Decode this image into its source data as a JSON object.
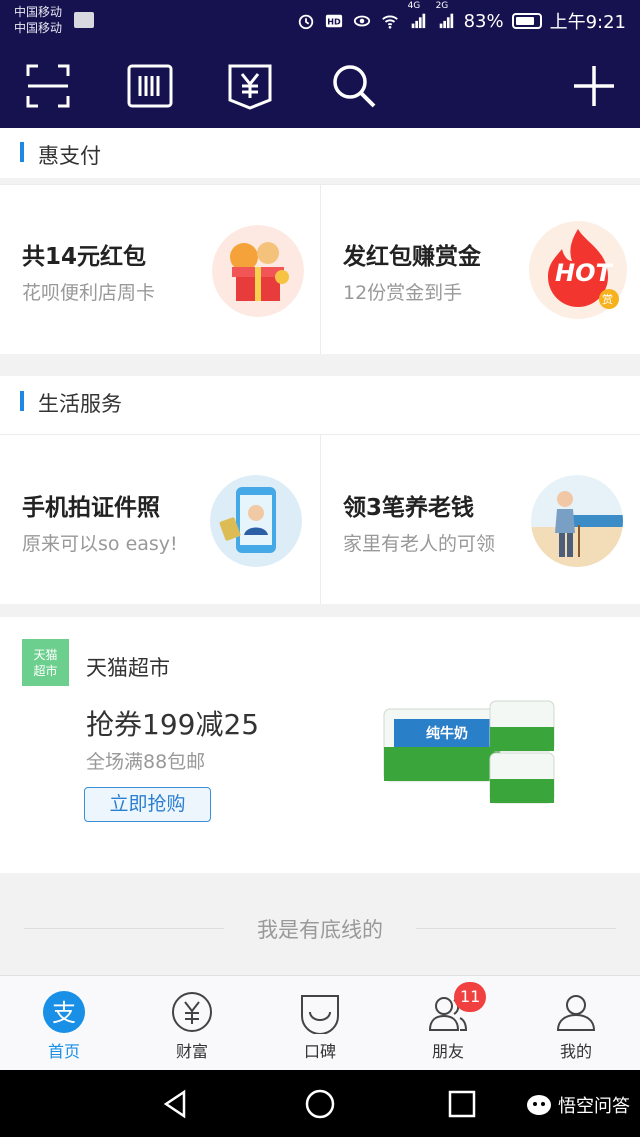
{
  "status_bar": {
    "carrier_1": "中国移动",
    "carrier_2": "中国移动",
    "network_1": "4G",
    "network_2": "2G",
    "battery": "83%",
    "time": "上午9:21"
  },
  "header": {
    "icons": [
      "scan-icon",
      "barcode-icon",
      "receipt-yuan-icon",
      "search-icon",
      "add-icon"
    ]
  },
  "section_huizhifu": {
    "title": "惠支付",
    "cards": [
      {
        "title": "共14元红包",
        "subtitle": "花呗便利店周卡"
      },
      {
        "title": "发红包赚赏金",
        "subtitle": "12份赏金到手",
        "badge_text": "HOT",
        "badge_small": "赏"
      }
    ]
  },
  "section_life": {
    "title": "生活服务",
    "cards": [
      {
        "title": "手机拍证件照",
        "subtitle": "原来可以so easy!"
      },
      {
        "title": "领3笔养老钱",
        "subtitle": "家里有老人的可领"
      }
    ]
  },
  "tmall": {
    "logo_line1": "天猫",
    "logo_line2": "超市",
    "name": "天猫超市",
    "title": "抢券199减25",
    "subtitle": "全场满88包邮",
    "button": "立即抢购",
    "product_label": "纯牛奶"
  },
  "footer_note": "我是有底线的",
  "tabs": [
    {
      "label": "首页",
      "icon": "alipay-icon",
      "active": true
    },
    {
      "label": "财富",
      "icon": "wealth-icon"
    },
    {
      "label": "口碑",
      "icon": "koubei-icon"
    },
    {
      "label": "朋友",
      "icon": "friends-icon",
      "badge": "11"
    },
    {
      "label": "我的",
      "icon": "profile-icon"
    }
  ],
  "watermark": "悟空问答",
  "colors": {
    "header_bg": "#16124f",
    "accent": "#1a8fe6",
    "badge": "#f04040",
    "tmall_green": "#6dcf8e"
  }
}
